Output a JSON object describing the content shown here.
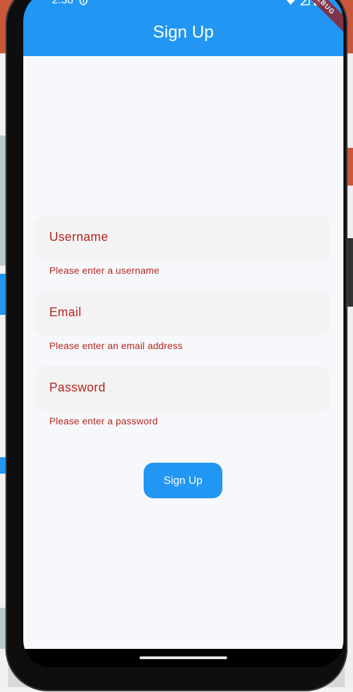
{
  "status_bar": {
    "time": "2:38"
  },
  "app_bar": {
    "title": "Sign Up",
    "debug_banner": "DEBUG"
  },
  "form": {
    "username": {
      "label": "Username",
      "error": "Please enter a username"
    },
    "email": {
      "label": "Email",
      "error": "Please enter an email address"
    },
    "password": {
      "label": "Password",
      "error": "Please enter a password"
    },
    "submit_label": "Sign Up"
  },
  "colors": {
    "primary": "#2196f3",
    "error": "#b3261e",
    "background": "#f7f8fb",
    "field_fill": "#f4f3f4"
  }
}
